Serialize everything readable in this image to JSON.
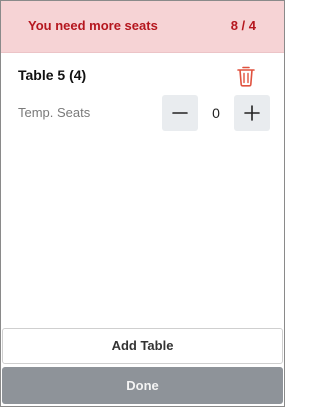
{
  "alert": {
    "message": "You need more seats",
    "count": "8 / 4",
    "color": "#b5161e",
    "background": "#f6d3d5"
  },
  "table": {
    "title": "Table 5 (4)",
    "delete_icon": "trash-icon",
    "temp_seats": {
      "label": "Temp. Seats",
      "value": "0",
      "minus_icon": "minus-icon",
      "plus_icon": "plus-icon"
    }
  },
  "actions": {
    "add_table_label": "Add Table",
    "done_label": "Done"
  }
}
